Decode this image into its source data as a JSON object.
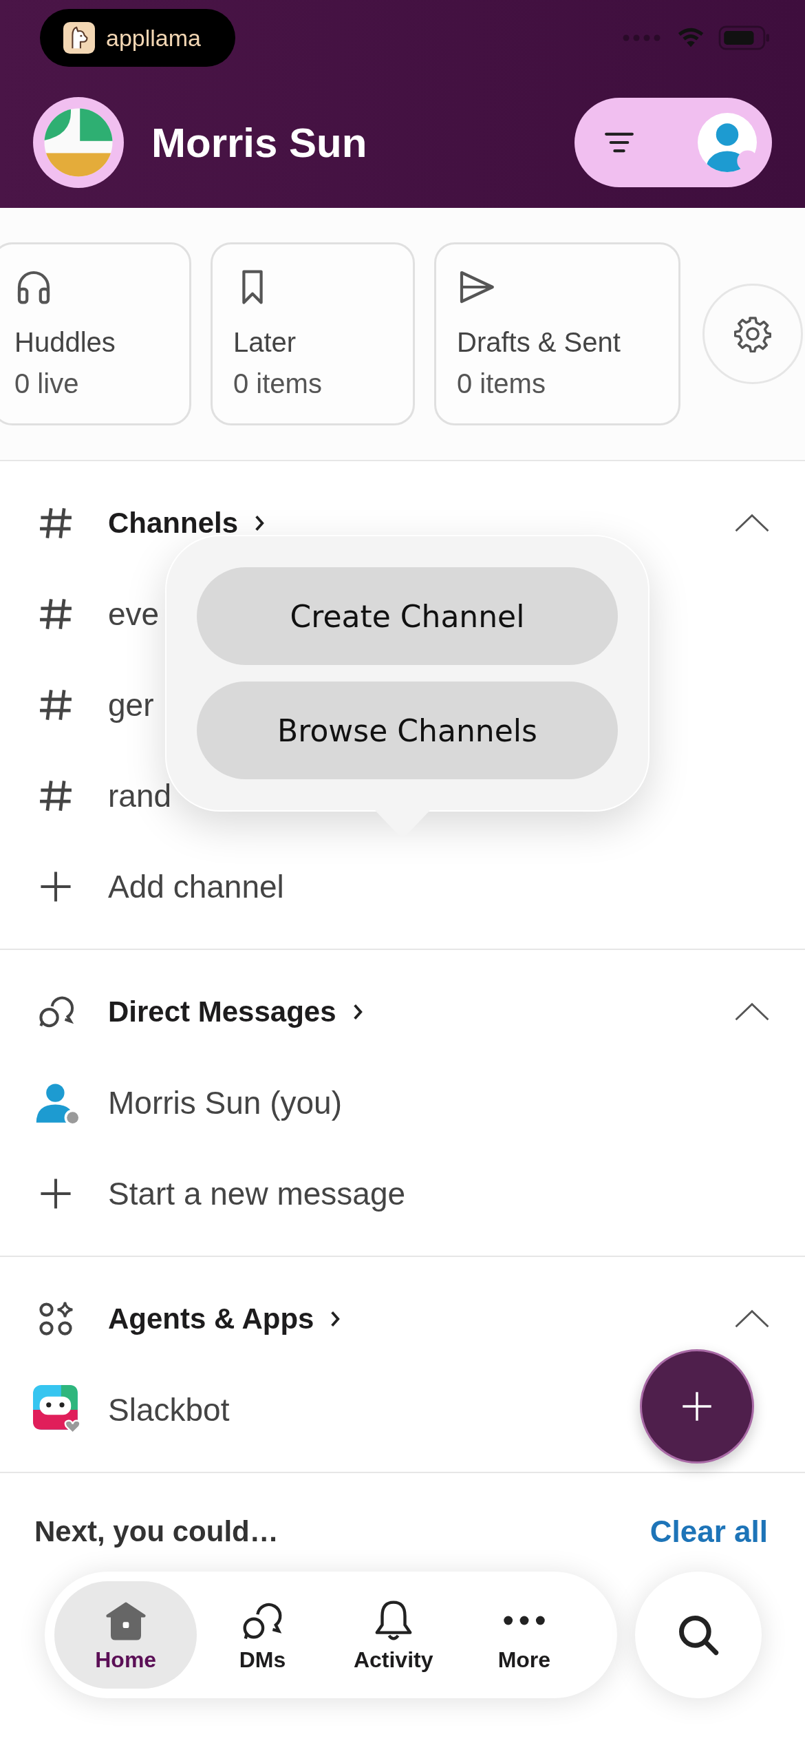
{
  "status_bar": {
    "app_badge": "appllama"
  },
  "header": {
    "workspace": "Morris Sun"
  },
  "shortcuts": [
    {
      "kind": "headphones",
      "title": "Huddles",
      "subtitle": "0 live"
    },
    {
      "kind": "bookmark",
      "title": "Later",
      "subtitle": "0 items"
    },
    {
      "kind": "send",
      "title": "Drafts & Sent",
      "subtitle": "0 items"
    }
  ],
  "sections": [
    {
      "kind": "channels",
      "title": "Channels",
      "expanded": true,
      "items": [
        {
          "kind": "channel",
          "label": "eve"
        },
        {
          "kind": "channel",
          "label": "ger"
        },
        {
          "kind": "channel",
          "label": "rand"
        },
        {
          "kind": "add",
          "label": "Add channel"
        }
      ]
    },
    {
      "kind": "dms",
      "title": "Direct Messages",
      "expanded": true,
      "items": [
        {
          "kind": "user",
          "label": "Morris Sun (you)"
        },
        {
          "kind": "add",
          "label": "Start a new message"
        }
      ]
    },
    {
      "kind": "apps",
      "title": "Agents & Apps",
      "expanded": true,
      "items": [
        {
          "kind": "bot",
          "label": "Slackbot"
        }
      ]
    }
  ],
  "popover": {
    "actions": [
      "Create Channel",
      "Browse Channels"
    ]
  },
  "suggestions": {
    "title": "Next, you could…",
    "action": "Clear all"
  },
  "tab_bar": {
    "tabs": [
      {
        "kind": "home",
        "label": "Home",
        "selected": true
      },
      {
        "kind": "dms",
        "label": "DMs",
        "selected": false
      },
      {
        "kind": "activity",
        "label": "Activity",
        "selected": false
      },
      {
        "kind": "more",
        "label": "More",
        "selected": false
      }
    ]
  }
}
